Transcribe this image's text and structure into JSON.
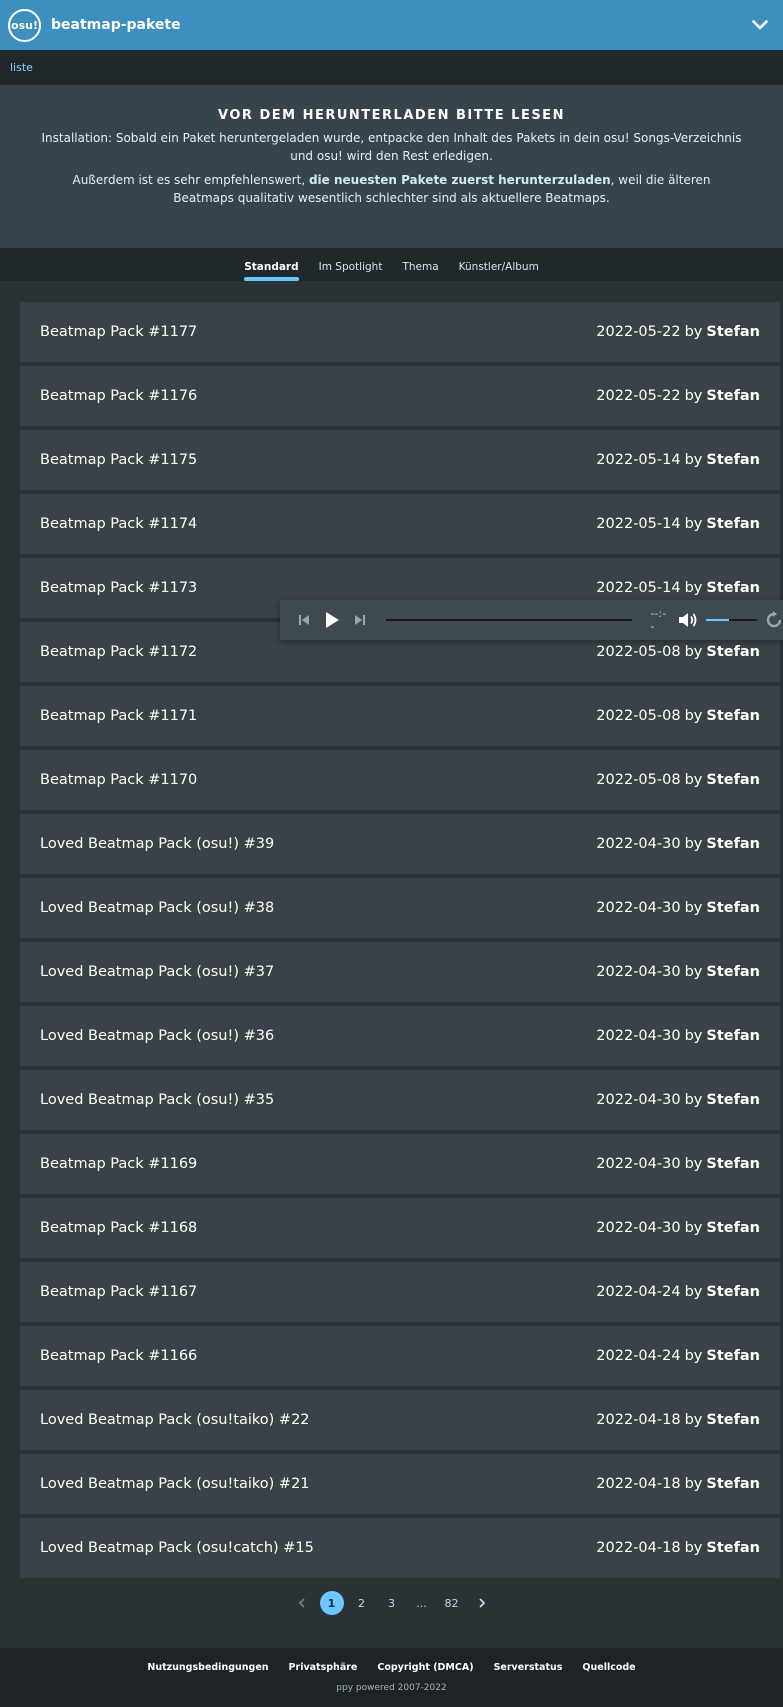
{
  "header": {
    "logo_text": "osu!",
    "title": "beatmap-pakete",
    "menu_icon": "chevron-down-icon"
  },
  "breadcrumb": {
    "item": "liste"
  },
  "notice": {
    "heading": "VOR DEM HERUNTERLADEN BITTE LESEN",
    "p1": "Installation: Sobald ein Paket heruntergeladen wurde, entpacke den Inhalt des Pakets in dein osu! Songs-Verzeichnis und osu! wird den Rest erledigen.",
    "p2_before": "Außerdem ist es sehr empfehlenswert, ",
    "p2_bold": "die neuesten Pakete zuerst herunterzuladen",
    "p2_after": ", weil die älteren Beatmaps qualitativ wesentlich schlechter sind als aktuellere Beatmaps."
  },
  "tabs": [
    {
      "label": "Standard",
      "active": true
    },
    {
      "label": "Im Spotlight",
      "active": false
    },
    {
      "label": "Thema",
      "active": false
    },
    {
      "label": "Künstler/Album",
      "active": false
    }
  ],
  "packs": [
    {
      "name": "Beatmap Pack #1177",
      "date": "2022-05-22",
      "by": "by",
      "author": "Stefan"
    },
    {
      "name": "Beatmap Pack #1176",
      "date": "2022-05-22",
      "by": "by",
      "author": "Stefan"
    },
    {
      "name": "Beatmap Pack #1175",
      "date": "2022-05-14",
      "by": "by",
      "author": "Stefan"
    },
    {
      "name": "Beatmap Pack #1174",
      "date": "2022-05-14",
      "by": "by",
      "author": "Stefan"
    },
    {
      "name": "Beatmap Pack #1173",
      "date": "2022-05-14",
      "by": "by",
      "author": "Stefan"
    },
    {
      "name": "Beatmap Pack #1172",
      "date": "2022-05-08",
      "by": "by",
      "author": "Stefan"
    },
    {
      "name": "Beatmap Pack #1171",
      "date": "2022-05-08",
      "by": "by",
      "author": "Stefan"
    },
    {
      "name": "Beatmap Pack #1170",
      "date": "2022-05-08",
      "by": "by",
      "author": "Stefan"
    },
    {
      "name": "Loved Beatmap Pack (osu!) #39",
      "date": "2022-04-30",
      "by": "by",
      "author": "Stefan"
    },
    {
      "name": "Loved Beatmap Pack (osu!) #38",
      "date": "2022-04-30",
      "by": "by",
      "author": "Stefan"
    },
    {
      "name": "Loved Beatmap Pack (osu!) #37",
      "date": "2022-04-30",
      "by": "by",
      "author": "Stefan"
    },
    {
      "name": "Loved Beatmap Pack (osu!) #36",
      "date": "2022-04-30",
      "by": "by",
      "author": "Stefan"
    },
    {
      "name": "Loved Beatmap Pack (osu!) #35",
      "date": "2022-04-30",
      "by": "by",
      "author": "Stefan"
    },
    {
      "name": "Beatmap Pack #1169",
      "date": "2022-04-30",
      "by": "by",
      "author": "Stefan"
    },
    {
      "name": "Beatmap Pack #1168",
      "date": "2022-04-30",
      "by": "by",
      "author": "Stefan"
    },
    {
      "name": "Beatmap Pack #1167",
      "date": "2022-04-24",
      "by": "by",
      "author": "Stefan"
    },
    {
      "name": "Beatmap Pack #1166",
      "date": "2022-04-24",
      "by": "by",
      "author": "Stefan"
    },
    {
      "name": "Loved Beatmap Pack (osu!taiko) #22",
      "date": "2022-04-18",
      "by": "by",
      "author": "Stefan"
    },
    {
      "name": "Loved Beatmap Pack (osu!taiko) #21",
      "date": "2022-04-18",
      "by": "by",
      "author": "Stefan"
    },
    {
      "name": "Loved Beatmap Pack (osu!catch) #15",
      "date": "2022-04-18",
      "by": "by",
      "author": "Stefan"
    }
  ],
  "player": {
    "time": "--:--",
    "volume_fraction": 0.45,
    "icons": [
      "skip-back-icon",
      "play-icon",
      "skip-forward-icon",
      "volume-icon",
      "repeat-icon"
    ]
  },
  "pagination": {
    "prev_icon": "chevron-left-icon",
    "pages": [
      "1",
      "2",
      "3",
      "...",
      "82"
    ],
    "current": "1",
    "next_icon": "chevron-right-icon"
  },
  "footer": {
    "links": [
      "Nutzungsbedingungen",
      "Privatsphäre",
      "Copyright (DMCA)",
      "Serverstatus",
      "Quellcode"
    ],
    "copyright": "ppy powered 2007-2022"
  },
  "colors": {
    "accent": "#6bc7ff",
    "header": "#3d8fbd",
    "row": "#394247"
  }
}
